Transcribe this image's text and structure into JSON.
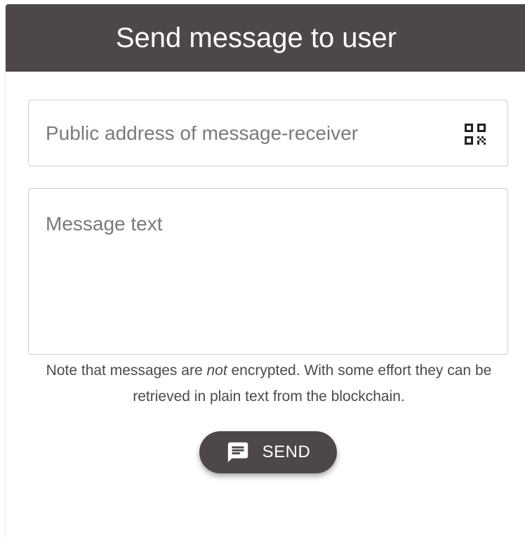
{
  "dialog": {
    "title": "Send message to user",
    "header_color": "#4d474b"
  },
  "address_field": {
    "placeholder": "Public address of message-receiver",
    "value": "",
    "icon": "qr-code-icon"
  },
  "message_field": {
    "placeholder": "Message text",
    "value": ""
  },
  "note": {
    "before": "Note that messages are ",
    "emphasis": "not",
    "after": " encrypted. With some effort they can be retrieved in plain text from the blockchain."
  },
  "send_button": {
    "label": "SEND",
    "icon": "message-icon",
    "color": "#4d474b"
  }
}
